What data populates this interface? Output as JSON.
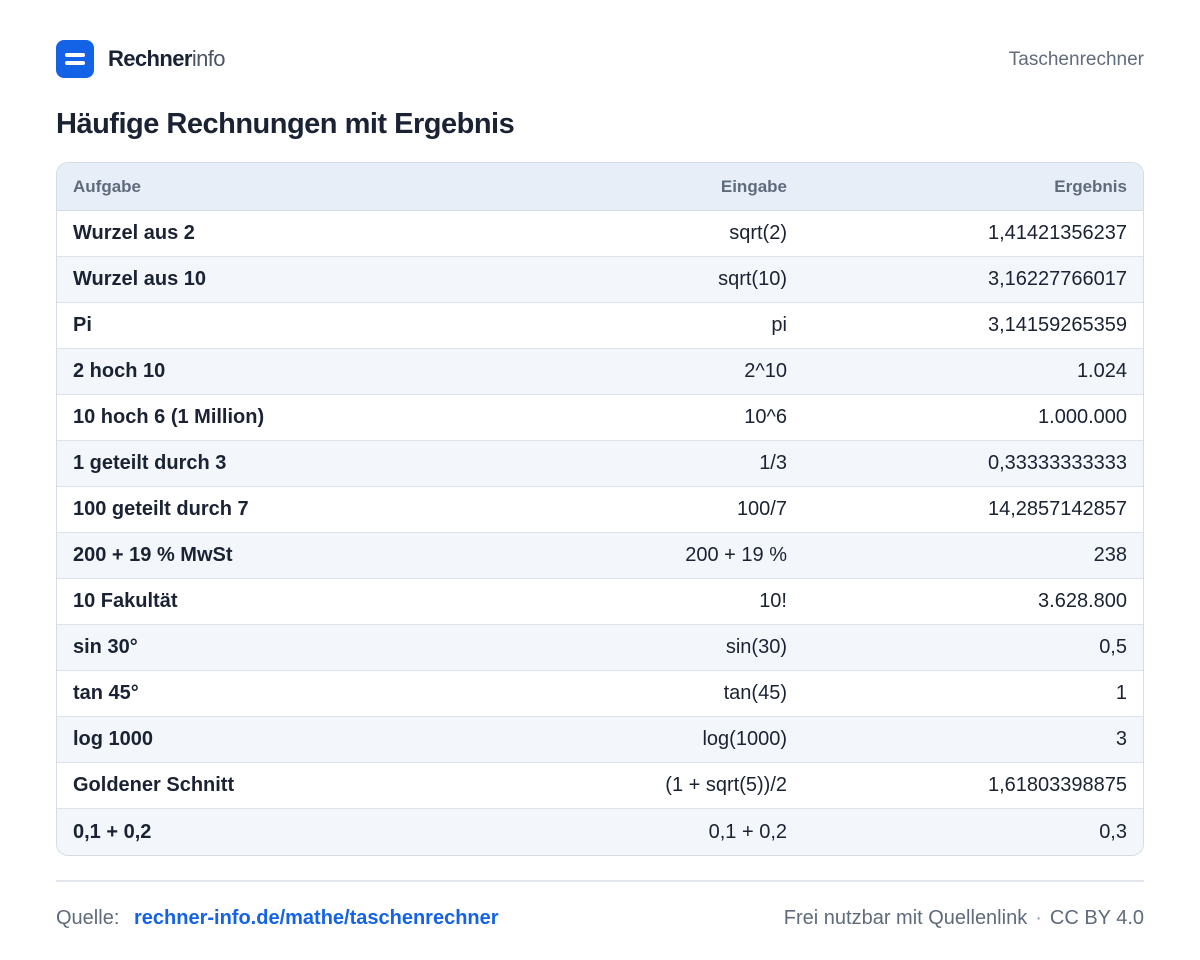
{
  "header": {
    "brand_strong": "Rechner",
    "brand_light": "info",
    "nav_link": "Taschenrechner"
  },
  "page": {
    "title": "Häufige Rechnungen mit Ergebnis"
  },
  "table": {
    "columns": [
      "Aufgabe",
      "Eingabe",
      "Ergebnis"
    ],
    "rows": [
      [
        "Wurzel aus 2",
        "sqrt(2)",
        "1,41421356237"
      ],
      [
        "Wurzel aus 10",
        "sqrt(10)",
        "3,16227766017"
      ],
      [
        "Pi",
        "pi",
        "3,14159265359"
      ],
      [
        "2 hoch 10",
        "2^10",
        "1.024"
      ],
      [
        "10 hoch 6 (1 Million)",
        "10^6",
        "1.000.000"
      ],
      [
        "1 geteilt durch 3",
        "1/3",
        "0,33333333333"
      ],
      [
        "100 geteilt durch 7",
        "100/7",
        "14,2857142857"
      ],
      [
        "200 + 19 % MwSt",
        "200 + 19 %",
        "238"
      ],
      [
        "10 Fakultät",
        "10!",
        "3.628.800"
      ],
      [
        "sin 30°",
        "sin(30)",
        "0,5"
      ],
      [
        "tan 45°",
        "tan(45)",
        "1"
      ],
      [
        "log 1000",
        "log(1000)",
        "3"
      ],
      [
        "Goldener Schnitt",
        "(1 + sqrt(5))/2",
        "1,61803398875"
      ],
      [
        "0,1 + 0,2",
        "0,1 + 0,2",
        "0,3"
      ]
    ]
  },
  "footer": {
    "source_label": "Quelle:",
    "source_link": "rechner-info.de/mathe/taschenrechner",
    "license_text": "Frei nutzbar mit Quellenlink",
    "separator": "·",
    "license_name": "CC BY 4.0"
  },
  "colors": {
    "accent": "#1463e6",
    "text": "#1a2233",
    "muted": "#5f6b7c",
    "header_bg": "#e8eef7",
    "row_alt_bg": "#f3f7fc"
  },
  "icons": {
    "logo": "menu-lines-icon"
  }
}
